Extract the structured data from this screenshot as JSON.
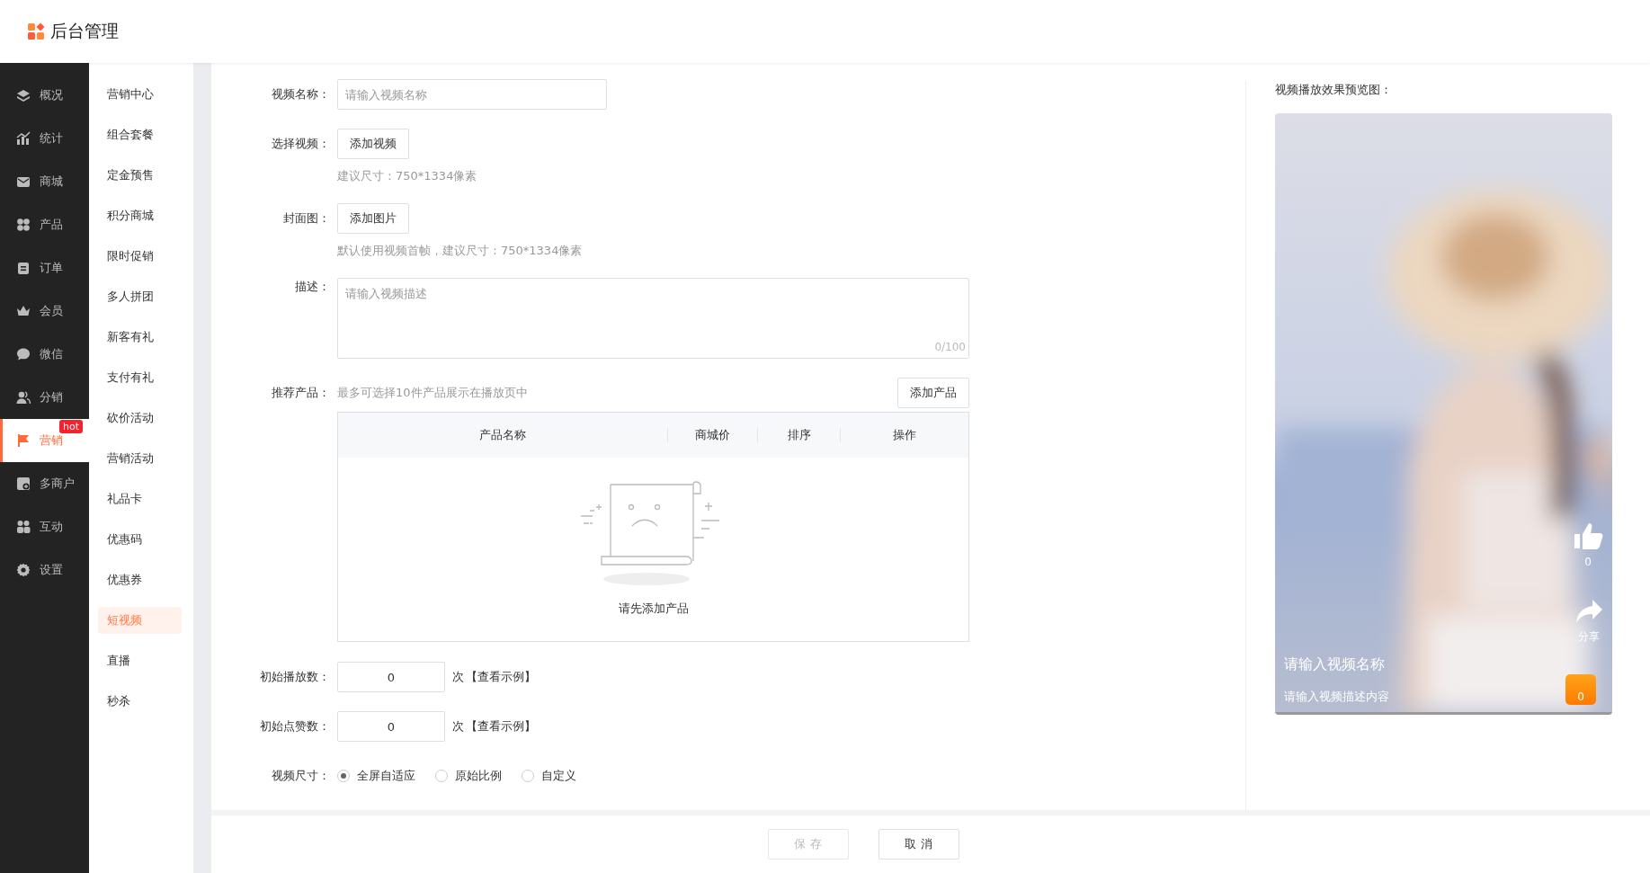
{
  "header": {
    "title": "后台管理"
  },
  "nav": [
    {
      "label": "概况",
      "selected": false
    },
    {
      "label": "统计",
      "selected": false
    },
    {
      "label": "商城",
      "selected": false
    },
    {
      "label": "产品",
      "selected": false
    },
    {
      "label": "订单",
      "selected": false
    },
    {
      "label": "会员",
      "selected": false
    },
    {
      "label": "微信",
      "selected": false
    },
    {
      "label": "分销",
      "selected": false
    },
    {
      "label": "营销",
      "selected": true,
      "badge": "hot"
    },
    {
      "label": "多商户",
      "selected": false
    },
    {
      "label": "互动",
      "selected": false
    },
    {
      "label": "设置",
      "selected": false
    }
  ],
  "sub_nav": [
    {
      "label": "营销中心",
      "selected": false
    },
    {
      "label": "组合套餐",
      "selected": false
    },
    {
      "label": "定金预售",
      "selected": false
    },
    {
      "label": "积分商城",
      "selected": false
    },
    {
      "label": "限时促销",
      "selected": false
    },
    {
      "label": "多人拼团",
      "selected": false
    },
    {
      "label": "新客有礼",
      "selected": false
    },
    {
      "label": "支付有礼",
      "selected": false
    },
    {
      "label": "砍价活动",
      "selected": false
    },
    {
      "label": "营销活动",
      "selected": false
    },
    {
      "label": "礼品卡",
      "selected": false
    },
    {
      "label": "优惠码",
      "selected": false
    },
    {
      "label": "优惠券",
      "selected": false
    },
    {
      "label": "短视频",
      "selected": true
    },
    {
      "label": "直播",
      "selected": false
    },
    {
      "label": "秒杀",
      "selected": false
    }
  ],
  "form": {
    "video_name": {
      "label": "视频名称：",
      "placeholder": "请输入视频名称"
    },
    "select_video": {
      "label": "选择视频：",
      "button": "添加视频",
      "hint": "建议尺寸：750*1334像素"
    },
    "cover": {
      "label": "封面图：",
      "button": "添加图片",
      "hint": "默认使用视频首帧，建议尺寸：750*1334像素"
    },
    "description": {
      "label": "描述：",
      "placeholder": "请输入视频描述",
      "counter": "0/100"
    },
    "products": {
      "label": "推荐产品：",
      "hint": "最多可选择10件产品展示在播放页中",
      "button": "添加产品",
      "columns": [
        "产品名称",
        "商城价",
        "排序",
        "操作"
      ],
      "empty_text": "请先添加产品"
    },
    "play_count": {
      "label": "初始播放数：",
      "value": "0",
      "unit": "次",
      "link": "【查看示例】"
    },
    "like_count": {
      "label": "初始点赞数：",
      "value": "0",
      "unit": "次",
      "link": "【查看示例】"
    },
    "video_size": {
      "label": "视频尺寸：",
      "options": [
        {
          "label": "全屏自适应",
          "selected": true
        },
        {
          "label": "原始比例",
          "selected": false
        },
        {
          "label": "自定义",
          "selected": false
        }
      ]
    }
  },
  "preview": {
    "title": "视频播放效果预览图：",
    "likes": "0",
    "share": "分享",
    "video_title": "请输入视频名称",
    "video_desc": "请输入视频描述内容",
    "cart_count": "0"
  },
  "footer": {
    "buttons": [
      {
        "label": "保 存",
        "disabled": true
      },
      {
        "label": "取 消",
        "disabled": false
      }
    ]
  }
}
